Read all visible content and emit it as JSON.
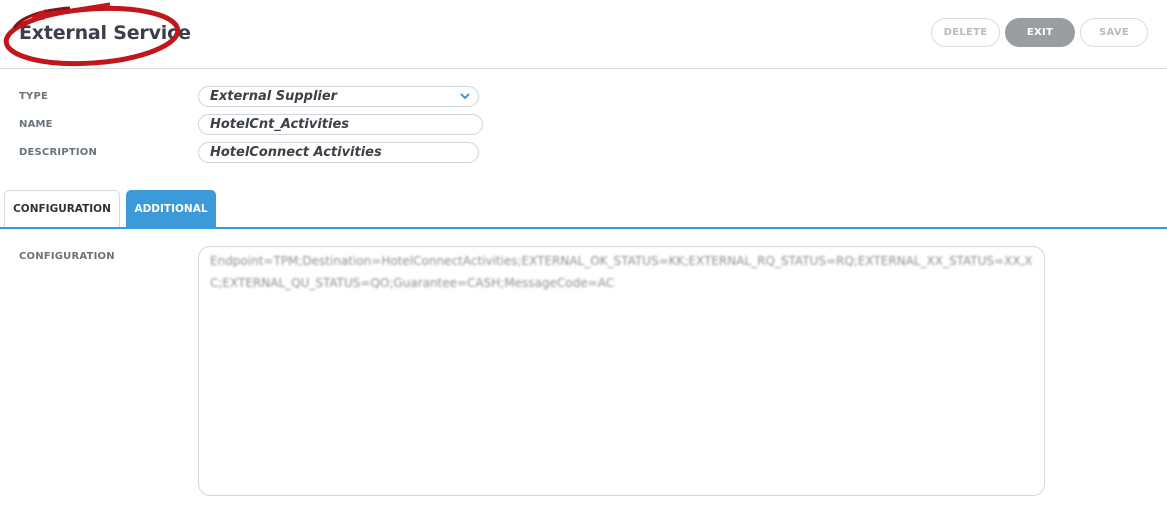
{
  "header": {
    "title": "External Service",
    "buttons": {
      "delete": "DELETE",
      "exit": "EXIT",
      "save": "SAVE"
    }
  },
  "form": {
    "type": {
      "label": "TYPE",
      "value": "External Supplier"
    },
    "name": {
      "label": "NAME",
      "value": "HotelCnt_Activities"
    },
    "description": {
      "label": "DESCRIPTION",
      "value": "HotelConnect Activities"
    }
  },
  "tabs": [
    {
      "label": "CONFIGURATION",
      "active": true
    },
    {
      "label": "ADDITIONAL",
      "active": false
    }
  ],
  "configuration": {
    "label": "CONFIGURATION",
    "value": "Endpoint=TPM;Destination=HotelConnectActivities;EXTERNAL_OK_STATUS=KK;EXTERNAL_RQ_STATUS=RQ;EXTERNAL_XX_STATUS=XX,XC;EXTERNAL_QU_STATUS=QO;Guarantee=CASH;MessageCode=AC"
  },
  "colors": {
    "accent": "#3b9ad9",
    "annotation": "#c0161c",
    "exit_button": "#9a9ea2"
  },
  "icons": {
    "type_dropdown": "chevron-down-icon"
  }
}
